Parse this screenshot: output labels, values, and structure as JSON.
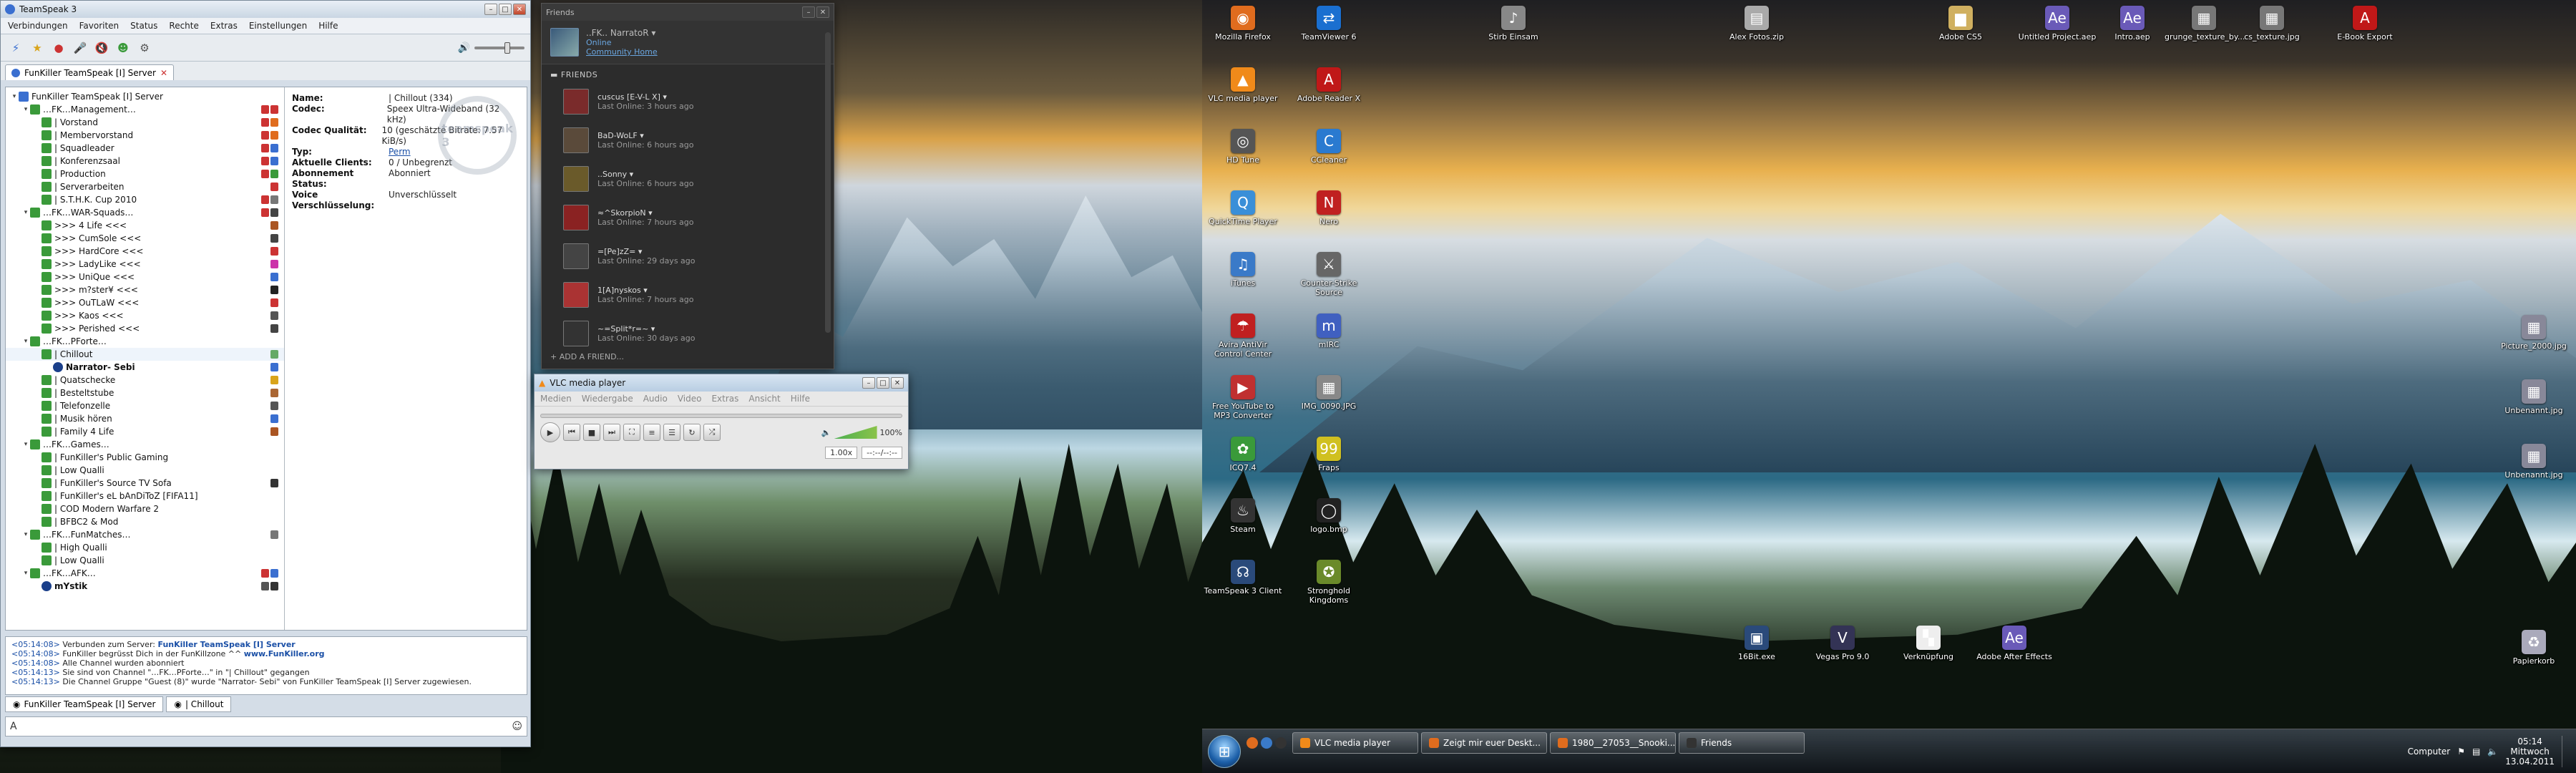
{
  "teamspeak": {
    "title": "TeamSpeak 3",
    "menu": [
      "Verbindungen",
      "Favoriten",
      "Status",
      "Rechte",
      "Extras",
      "Einstellungen",
      "Hilfe"
    ],
    "tab": "FunKiller TeamSpeak [I] Server",
    "tree": [
      {
        "label": "FunKiller TeamSpeak [I] Server",
        "depth": 0,
        "type": "server",
        "badges": []
      },
      {
        "label": "…FK…Management…",
        "depth": 1,
        "type": "spacer",
        "badges": [
          "#c33",
          "#c33"
        ]
      },
      {
        "label": "| Vorstand",
        "depth": 2,
        "type": "channel",
        "badges": [
          "#c33",
          "#e06c1e"
        ]
      },
      {
        "label": "| Membervorstand",
        "depth": 2,
        "type": "channel",
        "badges": [
          "#c33",
          "#e06c1e"
        ]
      },
      {
        "label": "| Squadleader",
        "depth": 2,
        "type": "channel",
        "badges": [
          "#c33",
          "#3a6fd0"
        ]
      },
      {
        "label": "| Konferenzsaal",
        "depth": 2,
        "type": "channel",
        "badges": [
          "#c33",
          "#3a6fd0"
        ]
      },
      {
        "label": "| Production",
        "depth": 2,
        "type": "channel",
        "badges": [
          "#c33",
          "#3a9a3a"
        ]
      },
      {
        "label": "| Serverarbeiten",
        "depth": 2,
        "type": "channel",
        "badges": [
          "#c33"
        ]
      },
      {
        "label": "| S.T.H.K. Cup 2010",
        "depth": 2,
        "type": "channel",
        "badges": [
          "#c33",
          "#777"
        ]
      },
      {
        "label": "…FK…WAR-Squads…",
        "depth": 1,
        "type": "spacer",
        "badges": [
          "#c33",
          "#444"
        ]
      },
      {
        "label": ">>> 4 Life <<<",
        "depth": 2,
        "type": "channel",
        "badges": [
          "#a52"
        ]
      },
      {
        "label": ">>> CumSole <<<",
        "depth": 2,
        "type": "channel",
        "badges": [
          "#444"
        ]
      },
      {
        "label": ">>> HardCore <<<",
        "depth": 2,
        "type": "channel",
        "badges": [
          "#c33"
        ]
      },
      {
        "label": ">>> LadyLike <<<",
        "depth": 2,
        "type": "channel",
        "badges": [
          "#c3a"
        ]
      },
      {
        "label": ">>> UniQue <<<",
        "depth": 2,
        "type": "channel",
        "badges": [
          "#3a6fd0"
        ]
      },
      {
        "label": ">>> m?ster¥ <<<",
        "depth": 2,
        "type": "channel",
        "badges": [
          "#222"
        ]
      },
      {
        "label": ">>> OuTLaW <<<",
        "depth": 2,
        "type": "channel",
        "badges": [
          "#c33"
        ]
      },
      {
        "label": ">>> Kaos <<<",
        "depth": 2,
        "type": "channel",
        "badges": [
          "#555"
        ]
      },
      {
        "label": ">>> Perished <<<",
        "depth": 2,
        "type": "channel",
        "badges": [
          "#444"
        ]
      },
      {
        "label": "…FK…PForte…",
        "depth": 1,
        "type": "spacer",
        "badges": []
      },
      {
        "label": "| Chillout",
        "depth": 2,
        "type": "channel",
        "badges": [
          "#6a6"
        ],
        "selected": true
      },
      {
        "label": "Narrator- Sebi",
        "depth": 3,
        "type": "user",
        "badges": [
          "#3a6fd0"
        ]
      },
      {
        "label": "| Quatschecke",
        "depth": 2,
        "type": "channel",
        "badges": [
          "#d9a41a"
        ]
      },
      {
        "label": "| Besteltstube",
        "depth": 2,
        "type": "channel",
        "badges": [
          "#a63"
        ]
      },
      {
        "label": "| Telefonzelle",
        "depth": 2,
        "type": "channel",
        "badges": [
          "#555"
        ]
      },
      {
        "label": "| Musik hören",
        "depth": 2,
        "type": "channel",
        "badges": [
          "#3a6fd0"
        ]
      },
      {
        "label": "| Family 4 Life",
        "depth": 2,
        "type": "channel",
        "badges": [
          "#a52"
        ]
      },
      {
        "label": "…FK…Games…",
        "depth": 1,
        "type": "spacer",
        "badges": []
      },
      {
        "label": "| FunKiller's Public Gaming",
        "depth": 2,
        "type": "channel",
        "badges": []
      },
      {
        "label": "| Low Qualli",
        "depth": 2,
        "type": "channel",
        "badges": []
      },
      {
        "label": "| FunKiller's Source TV Sofa",
        "depth": 2,
        "type": "channel",
        "badges": [
          "#333"
        ]
      },
      {
        "label": "| FunKiller's eL bAnDiToZ [FIFA11]",
        "depth": 2,
        "type": "channel",
        "badges": []
      },
      {
        "label": "| COD Modern Warfare 2",
        "depth": 2,
        "type": "channel",
        "badges": []
      },
      {
        "label": "| BFBC2 & Mod",
        "depth": 2,
        "type": "channel",
        "badges": []
      },
      {
        "label": "…FK…FunMatches…",
        "depth": 1,
        "type": "spacer",
        "badges": [
          "#777"
        ]
      },
      {
        "label": "| High Qualli",
        "depth": 2,
        "type": "channel",
        "badges": []
      },
      {
        "label": "| Low Qualli",
        "depth": 2,
        "type": "channel",
        "badges": []
      },
      {
        "label": "…FK…AFK…",
        "depth": 1,
        "type": "spacer",
        "badges": [
          "#c33",
          "#3a6fd0"
        ]
      },
      {
        "label": "mYstik",
        "depth": 2,
        "type": "user",
        "badges": [
          "#555",
          "#333"
        ]
      }
    ],
    "info": [
      {
        "k": "Name:",
        "v": "| Chillout (334)"
      },
      {
        "k": "Codec:",
        "v": "Speex Ultra-Wideband (32 kHz)"
      },
      {
        "k": "Codec Qualität:",
        "v": "10 (geschätzte Bitrate: 7.57 KiB/s)"
      },
      {
        "k": "Typ:",
        "v": "Perm",
        "link": true
      },
      {
        "k": "Aktuelle Clients:",
        "v": "0 / Unbegrenzt"
      },
      {
        "k": "Abonnement Status:",
        "v": "Abonniert"
      },
      {
        "k": "Voice Verschlüsselung:",
        "v": "Unverschlüsselt"
      }
    ],
    "logo": "teamspeak 3",
    "chat": [
      {
        "t": "<05:14:08>",
        "m": " Verbunden zum Server: ",
        "b": "FunKiller TeamSpeak [I] Server"
      },
      {
        "t": "<05:14:08>",
        "m": " FunKiller begrüsst Dich in der FunKillzone ^^ ",
        "b": "www.FunKiller.org"
      },
      {
        "t": "<05:14:08>",
        "m": " Alle Channel wurden abonniert",
        "b": ""
      },
      {
        "t": "<05:14:13>",
        "m": " Sie sind von Channel \"…FK…PForte…\" in \"| Chillout\" gegangen",
        "b": ""
      },
      {
        "t": "<05:14:13>",
        "m": " Die Channel Gruppe \"Guest (8)\" wurde \"Narrator- Sebi\" von FunKiller TeamSpeak [I] Server zugewiesen.",
        "b": ""
      }
    ],
    "chat_tabs": [
      "FunKiller TeamSpeak [I] Server",
      "| Chillout"
    ]
  },
  "friends": {
    "title": "Friends",
    "me": {
      "name": "..FK.. NarratoR",
      "status": "Online",
      "community": "Community Home"
    },
    "section": "FRIENDS",
    "list": [
      {
        "name": "cuscus [E-V-L X]",
        "last": "Last Online: 3 hours ago",
        "color": "#7a2b2b"
      },
      {
        "name": "BaD-WoLF",
        "last": "Last Online: 6 hours ago",
        "color": "#5a4a3a"
      },
      {
        "name": "..Sonny",
        "last": "Last Online: 6 hours ago",
        "color": "#6a5a2a"
      },
      {
        "name": "≈^SkorpioN",
        "last": "Last Online: 7 hours ago",
        "color": "#8a2222"
      },
      {
        "name": "=[Pe]zZ=",
        "last": "Last Online: 29 days ago",
        "color": "#444"
      },
      {
        "name": "1[A]nyskos",
        "last": "Last Online: 7 hours ago",
        "color": "#a33"
      },
      {
        "name": "~=Split*r=~",
        "last": "Last Online: 30 days ago",
        "color": "#333"
      }
    ],
    "add": "+ ADD A FRIEND..."
  },
  "vlc": {
    "title": "VLC media player",
    "menu": [
      "Medien",
      "Wiedergabe",
      "Audio",
      "Video",
      "Extras",
      "Ansicht",
      "Hilfe"
    ],
    "volume": "100%",
    "speed": "1.00x",
    "time": "--:--/--:--"
  },
  "desktop": {
    "icons": [
      {
        "label": "Mozilla Firefox",
        "color": "#e06c1e",
        "glyph": "◉"
      },
      {
        "label": "TeamViewer 6",
        "color": "#1a6fd0",
        "glyph": "⇄"
      },
      {
        "label": "VLC media player",
        "color": "#f08a1a",
        "glyph": "▲"
      },
      {
        "label": "Adobe Reader X",
        "color": "#c01818",
        "glyph": "A"
      },
      {
        "label": "HD Tune",
        "color": "#555",
        "glyph": "◎"
      },
      {
        "label": "CCleaner",
        "color": "#2a7ad0",
        "glyph": "C"
      },
      {
        "label": "QuickTime Player",
        "color": "#3a8fd8",
        "glyph": "Q"
      },
      {
        "label": "Nero",
        "color": "#c02020",
        "glyph": "N"
      },
      {
        "label": "iTunes",
        "color": "#3a7ac8",
        "glyph": "♫"
      },
      {
        "label": "Counter-Strike Source",
        "color": "#666",
        "glyph": "⚔"
      },
      {
        "label": "Avira AntiVir Control Center",
        "color": "#c02020",
        "glyph": "☂"
      },
      {
        "label": "mIRC",
        "color": "#4060c0",
        "glyph": "m"
      },
      {
        "label": "Free YouTube to MP3 Converter",
        "color": "#c03030",
        "glyph": "▶"
      },
      {
        "label": "IMG_0090.JPG",
        "color": "#888",
        "glyph": "▦"
      },
      {
        "label": "ICQ7.4",
        "color": "#3a9a3a",
        "glyph": "✿"
      },
      {
        "label": "Fraps",
        "color": "#d0c020",
        "glyph": "99"
      },
      {
        "label": "Steam",
        "color": "#333",
        "glyph": "♨"
      },
      {
        "label": "logo.bmp",
        "color": "#222",
        "glyph": "◯"
      },
      {
        "label": "TeamSpeak 3 Client",
        "color": "#2a4a7a",
        "glyph": "☊"
      },
      {
        "label": "Stronghold Kingdoms",
        "color": "#6a8a2a",
        "glyph": "✪"
      }
    ],
    "top_icons": [
      {
        "label": "Stirb Einsam",
        "color": "#888",
        "glyph": "♪"
      },
      {
        "label": "Alex Fotos.zip",
        "color": "#aaa",
        "glyph": "▤"
      },
      {
        "label": "Adobe CS5",
        "color": "#d0b060",
        "glyph": "▆"
      },
      {
        "label": "Untitled Project.aep",
        "color": "#6a5ab8",
        "glyph": "Ae"
      },
      {
        "label": "Intro.aep",
        "color": "#6a5ab8",
        "glyph": "Ae"
      },
      {
        "label": "grunge_texture_by...",
        "color": "#777",
        "glyph": "▦"
      },
      {
        "label": "cs_texture.jpg",
        "color": "#777",
        "glyph": "▦"
      },
      {
        "label": "E-Book Export",
        "color": "#c01818",
        "glyph": "A"
      }
    ],
    "bottom_icons": [
      {
        "label": "16Bit.exe",
        "color": "#2a4a7a",
        "glyph": "▣"
      },
      {
        "label": "Vegas Pro 9.0",
        "color": "#335",
        "glyph": "V"
      },
      {
        "label": "Verknüpfung",
        "color": "#eee",
        "glyph": "▚"
      },
      {
        "label": "Adobe After Effects",
        "color": "#6a5ab8",
        "glyph": "Ae"
      }
    ],
    "right_icons": [
      {
        "label": "Picture_2000.jpg",
        "color": "#889",
        "glyph": "▦"
      },
      {
        "label": "Unbenannt.jpg",
        "color": "#889",
        "glyph": "▦"
      },
      {
        "label": "Unbenannt.jpg",
        "color": "#889",
        "glyph": "▦"
      },
      {
        "label": "Papierkorb",
        "color": "#aab",
        "glyph": "♻"
      }
    ]
  },
  "taskbar": {
    "buttons": [
      {
        "label": "VLC media player",
        "color": "#f08a1a"
      },
      {
        "label": "Zeigt mir euer Deskt...",
        "color": "#e06c1e"
      },
      {
        "label": "1980__27053__Snooki...",
        "color": "#e06c1e"
      },
      {
        "label": "Friends",
        "color": "#333"
      }
    ],
    "computer": "Computer",
    "time": "05:14",
    "day": "Mittwoch",
    "date": "13.04.2011"
  }
}
